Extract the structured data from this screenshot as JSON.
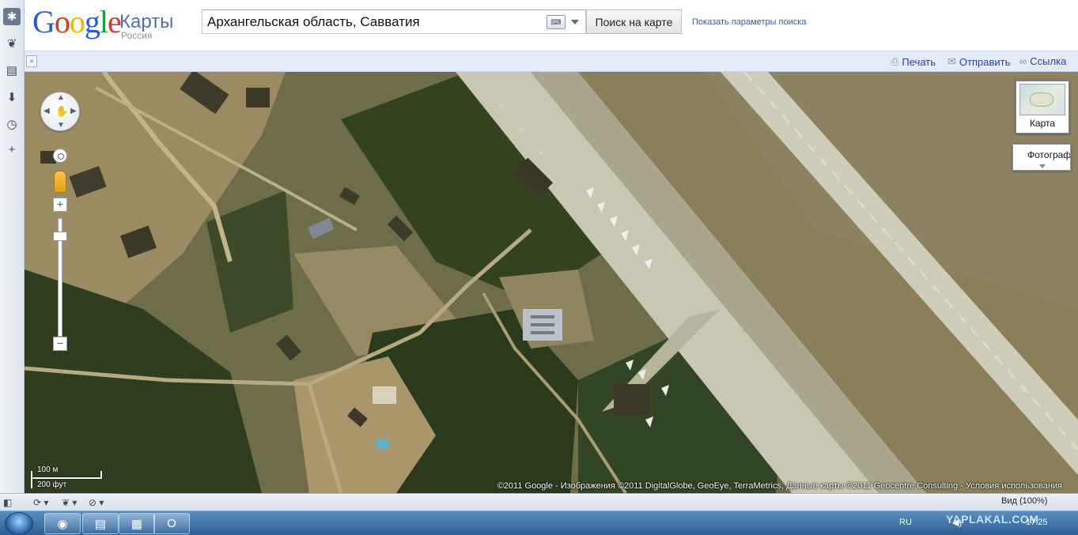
{
  "header": {
    "logo_text": "Google",
    "product": "Карты",
    "region": "Россия",
    "search_value": "Архангельская область, Савватия",
    "search_button": "Поиск на карте",
    "search_options_link": "Показать параметры поиска"
  },
  "toolbar": {
    "collapse_symbol": "»",
    "print_label": "Печать",
    "send_label": "Отправить",
    "link_label": "Ссылка"
  },
  "map": {
    "map_type_button": "Карта",
    "photo_button": "Фотограф",
    "scale_metric": "100 м",
    "scale_imperial": "200 фут",
    "copyright": "©2011 Google - Изображения ©2011 DigitalGlobe, GeoEye, TerraMetrics, Данные карты ©2011 Geocentre Consulting - Условия использования"
  },
  "statusbar": {
    "zoom_label": "Вид (100%)"
  },
  "taskbar": {
    "language": "RU",
    "time": "17:25",
    "watermark": "YAPLAKAL.COM"
  },
  "colors": {
    "accent_link": "#2a3fa8",
    "toolbar_bg": "#e5ecf9",
    "runway": "#c9c6b4",
    "forest": "#2f3f1f"
  }
}
